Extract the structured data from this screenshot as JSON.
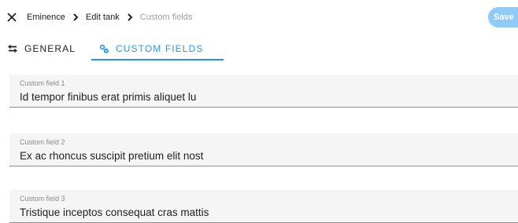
{
  "header": {
    "close_icon": "close-icon",
    "breadcrumbs": [
      {
        "label": "Eminence"
      },
      {
        "label": "Edit tank"
      },
      {
        "label": "Custom fields"
      }
    ],
    "separator_icon": "chevron-right-icon",
    "save_label": "Save"
  },
  "tabs": [
    {
      "label": "GENERAL",
      "icon": "swap-horizontal-icon"
    },
    {
      "label": "CUSTOM FIELDS",
      "icon": "settings-cogs-icon",
      "active": true
    }
  ],
  "fields": [
    {
      "label": "Custom field 1",
      "value": "Id tempor finibus erat primis aliquet lu"
    },
    {
      "label": "Custom field 2",
      "value": "Ex ac rhoncus suscipit pretium elit nost"
    },
    {
      "label": "Custom field 3",
      "value": "Tristique inceptos consequat cras mattis"
    }
  ],
  "colors": {
    "accent": "#2196f3",
    "save_button": "#90caf9",
    "field_background": "#f5f5f5",
    "muted_text": "#9e9e9e"
  }
}
